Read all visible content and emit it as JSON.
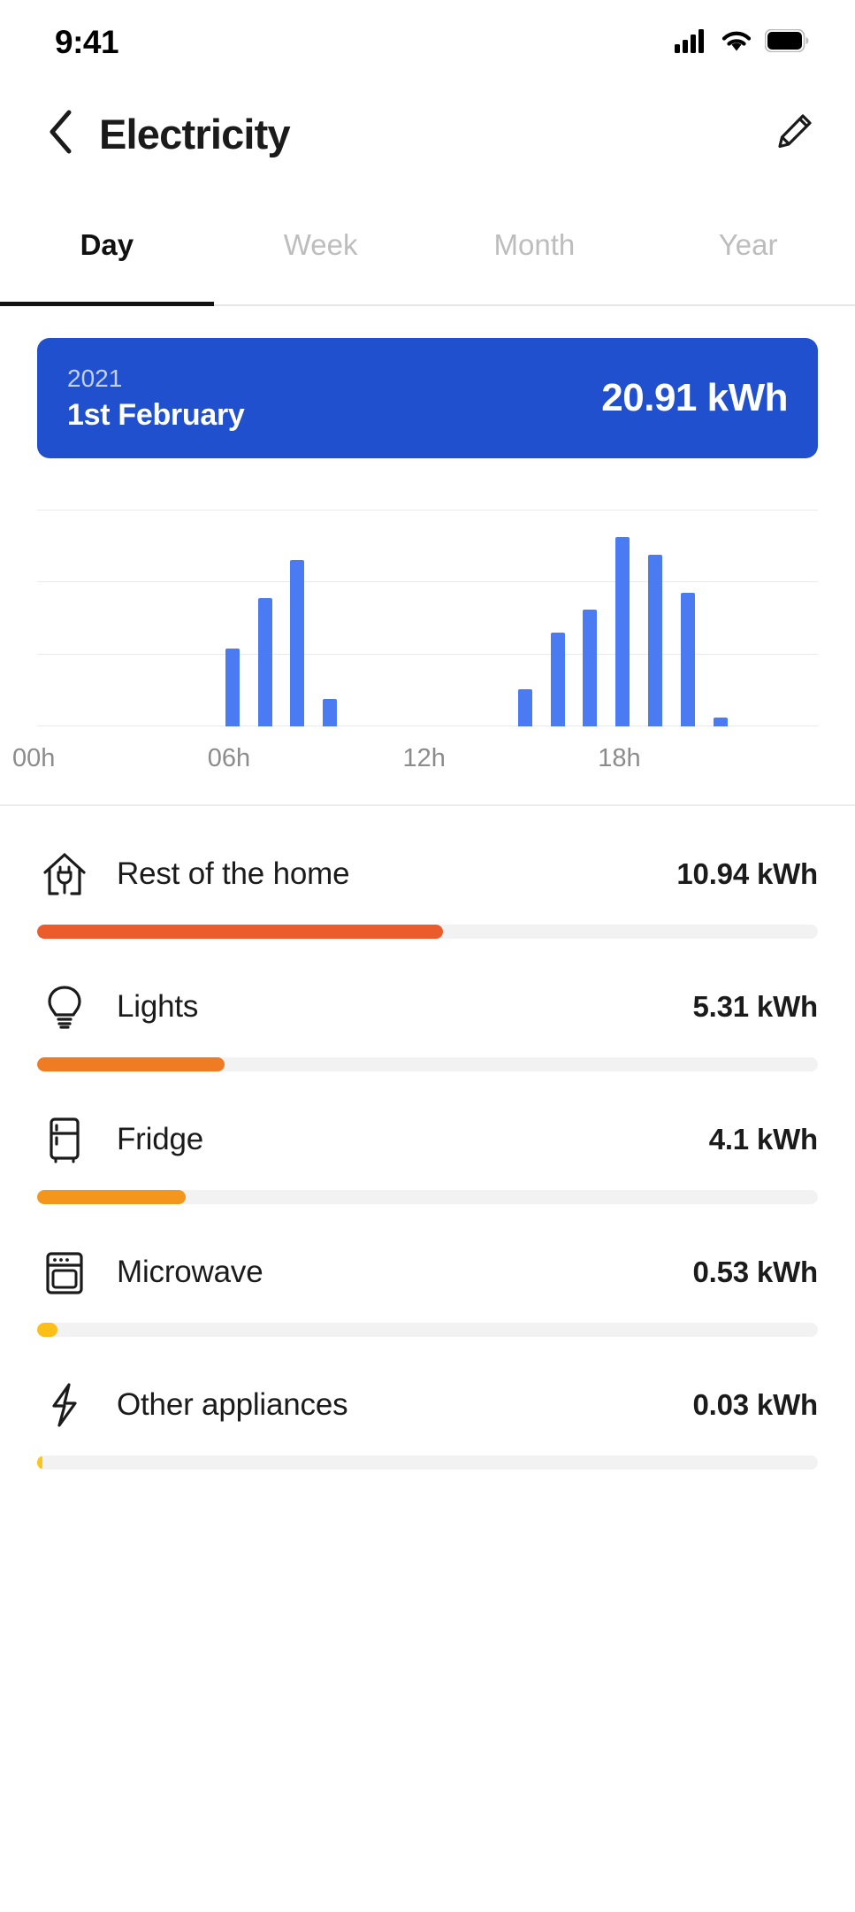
{
  "status_bar": {
    "time": "9:41",
    "icons": [
      "cellular-signal-icon",
      "wifi-icon",
      "battery-icon"
    ]
  },
  "header": {
    "back_icon": "chevron-left-icon",
    "title": "Electricity",
    "edit_icon": "pencil-icon"
  },
  "tabs": {
    "items": [
      {
        "label": "Day",
        "active": true
      },
      {
        "label": "Week",
        "active": false
      },
      {
        "label": "Month",
        "active": false
      },
      {
        "label": "Year",
        "active": false
      }
    ]
  },
  "summary_card": {
    "year": "2021",
    "date": "1st February",
    "value": "20.91 kWh",
    "background_color": "#2050CE"
  },
  "chart_data": {
    "type": "bar",
    "title": "",
    "xlabel": "",
    "ylabel": "",
    "bar_color": "#4a7bf2",
    "grid": true,
    "gridlines": 4,
    "legend": "none",
    "xlim": [
      0,
      24
    ],
    "ylim": [
      0,
      3.0
    ],
    "tick_labels": [
      "00h",
      "06h",
      "12h",
      "18h"
    ],
    "tick_hours": [
      0,
      6,
      12,
      18
    ],
    "x": [
      6,
      7,
      8,
      9,
      15,
      16,
      17,
      18,
      19,
      20,
      21
    ],
    "values": [
      1.08,
      1.78,
      2.3,
      0.38,
      0.52,
      1.3,
      1.62,
      2.62,
      2.38,
      1.85,
      0.12
    ],
    "unit": "kWh"
  },
  "breakdown": {
    "rows": [
      {
        "icon": "home-plug-icon",
        "label": "Rest of the home",
        "value": "10.94 kWh",
        "percent": 52,
        "color": "#EB5B2C"
      },
      {
        "icon": "lightbulb-icon",
        "label": "Lights",
        "value": "5.31 kWh",
        "percent": 24,
        "color": "#EF7C22"
      },
      {
        "icon": "fridge-icon",
        "label": "Fridge",
        "value": "4.1 kWh",
        "percent": 19,
        "color": "#F3961B"
      },
      {
        "icon": "microwave-icon",
        "label": "Microwave",
        "value": "0.53 kWh",
        "percent": 2.6,
        "color": "#FBBF17"
      },
      {
        "icon": "lightning-bolt-icon",
        "label": "Other appliances",
        "value": "0.03 kWh",
        "percent": 0.7,
        "color": "#FBC617"
      }
    ]
  }
}
